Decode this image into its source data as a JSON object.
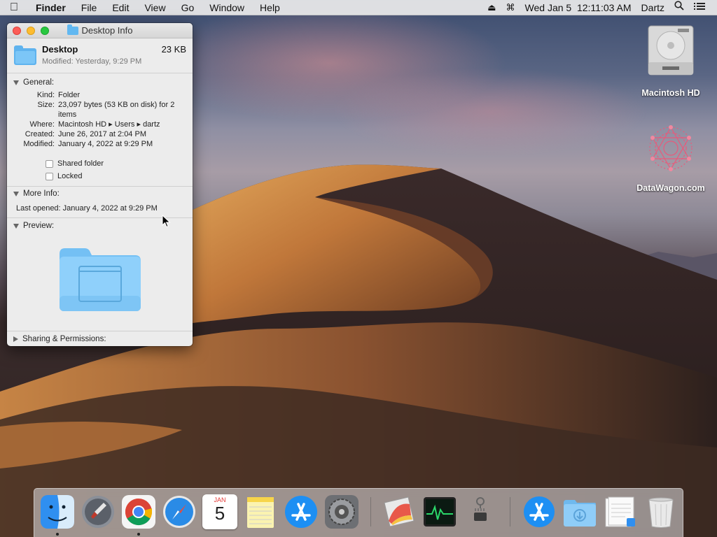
{
  "menubar": {
    "apple_icon": "apple-logo-icon",
    "app_name": "Finder",
    "menus": [
      "File",
      "Edit",
      "View",
      "Go",
      "Window",
      "Help"
    ],
    "status": {
      "eject_icon": "eject-icon",
      "keyboard_icon": "input-menu-icon",
      "clock": "Wed Jan 5  12:11:03 AM",
      "user": "Dartz",
      "spotlight_icon": "search-icon",
      "notification_icon": "list-icon"
    }
  },
  "info_window": {
    "title": "Desktop Info",
    "name": "Desktop",
    "size": "23 KB",
    "modified_summary": "Modified: Yesterday, 9:29 PM",
    "general": {
      "heading": "General:",
      "rows": [
        {
          "key": "Kind:",
          "value": "Folder"
        },
        {
          "key": "Size:",
          "value": "23,097 bytes (53 KB on disk) for 2 items"
        },
        {
          "key": "Where:",
          "value": "Macintosh HD ▸ Users ▸ dartz"
        },
        {
          "key": "Created:",
          "value": "June 26, 2017 at 2:04 PM"
        },
        {
          "key": "Modified:",
          "value": "January 4, 2022 at 9:29 PM"
        }
      ],
      "shared_folder_label": "Shared folder",
      "shared_folder_checked": false,
      "locked_label": "Locked",
      "locked_checked": false
    },
    "more_info": {
      "heading": "More Info:",
      "last_opened": "Last opened: January 4, 2022 at 9:29 PM"
    },
    "preview": {
      "heading": "Preview:"
    },
    "sharing": {
      "heading": "Sharing & Permissions:"
    }
  },
  "desktop_icons": [
    {
      "label": "Macintosh HD",
      "icon": "hard-drive-icon"
    },
    {
      "label": "DataWagon.com",
      "icon": "logo-image-icon"
    }
  ],
  "dock": {
    "items": [
      {
        "name": "Finder",
        "icon": "finder-icon",
        "running": true
      },
      {
        "name": "Launchpad",
        "icon": "launchpad-icon",
        "running": false
      },
      {
        "name": "Google Chrome",
        "icon": "chrome-icon",
        "running": true
      },
      {
        "name": "Safari",
        "icon": "safari-icon",
        "running": false
      },
      {
        "name": "Calendar",
        "icon": "calendar-icon",
        "running": false,
        "calendar_month": "JAN",
        "calendar_day": "5"
      },
      {
        "name": "Notes",
        "icon": "notes-icon",
        "running": false
      },
      {
        "name": "App Store",
        "icon": "app-store-icon",
        "running": false
      },
      {
        "name": "System Preferences",
        "icon": "system-preferences-icon",
        "running": false
      },
      {
        "name": "Grapher",
        "icon": "grapher-icon",
        "running": false
      },
      {
        "name": "Activity Monitor",
        "icon": "activity-monitor-icon",
        "running": false
      },
      {
        "name": "System Information",
        "icon": "system-information-icon",
        "running": false
      },
      {
        "name": "App Store Stack",
        "icon": "app-store-stack-icon",
        "running": false
      },
      {
        "name": "Downloads",
        "icon": "downloads-folder-icon",
        "running": false
      },
      {
        "name": "Documents",
        "icon": "documents-stack-icon",
        "running": false
      },
      {
        "name": "Trash",
        "icon": "trash-icon",
        "running": false
      }
    ]
  }
}
